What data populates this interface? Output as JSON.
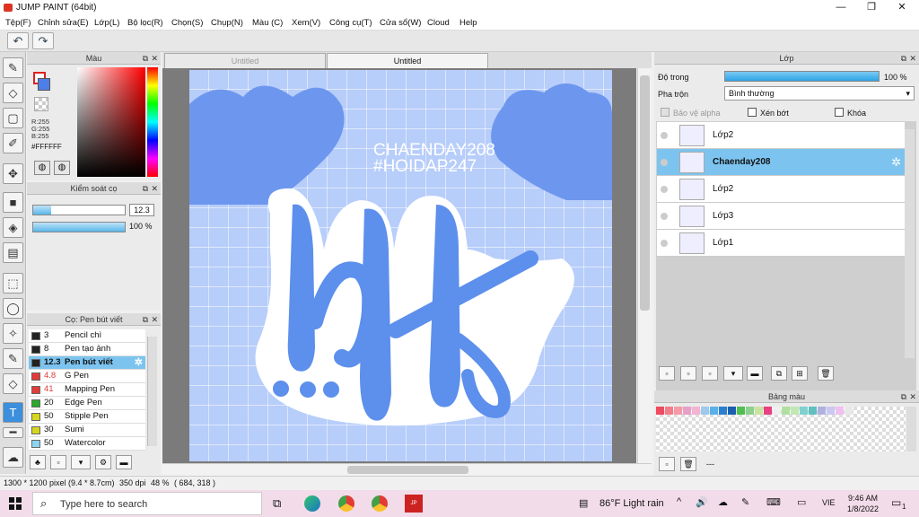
{
  "window": {
    "title": "JUMP PAINT (64bit)"
  },
  "menu": [
    "Tệp(F)",
    "Chỉnh sửa(E)",
    "Lớp(L)",
    "Bộ lọc(R)",
    "Chọn(S)",
    "Chụp(N)",
    "Màu (C)",
    "Xem(V)",
    "Công cụ(T)",
    "Cửa sổ(W)",
    "Cloud",
    "Help"
  ],
  "color_panel": {
    "title": "Màu",
    "r": "R:255",
    "g": "G:255",
    "b": "B:255",
    "hex": "#FFFFFF"
  },
  "brush_control": {
    "title": "Kiểm soát cọ",
    "size": "12.3",
    "opacity": "100 %",
    "size_fraction": 0.2,
    "opacity_fraction": 1.0
  },
  "brush_list": {
    "title": "Cọ: Pen bút viết",
    "items": [
      {
        "size": "3",
        "name": "Pencil chì",
        "color": "#222222"
      },
      {
        "size": "8",
        "name": "Pen tạo ảnh",
        "color": "#222222"
      },
      {
        "size": "12.3",
        "name": "Pen bút viết",
        "color": "#222222",
        "selected": true
      },
      {
        "size": "4.8",
        "name": "G Pen",
        "color": "#e33b3b"
      },
      {
        "size": "41",
        "name": "Mapping Pen",
        "color": "#e33b3b"
      },
      {
        "size": "20",
        "name": "Edge Pen",
        "color": "#2ba82b"
      },
      {
        "size": "50",
        "name": "Stipple Pen",
        "color": "#d6d61e"
      },
      {
        "size": "30",
        "name": "Sumi",
        "color": "#d6d61e"
      },
      {
        "size": "50",
        "name": "Watercolor",
        "color": "#8ad6f0"
      }
    ]
  },
  "tabs": [
    "Untitled",
    "Untitled"
  ],
  "artwork": {
    "line1": "CHAENDAY208",
    "line2": "#HOIDAP247"
  },
  "layer_panel": {
    "title": "Lớp",
    "opacity_label": "Độ trong",
    "opacity_value": "100 %",
    "blend_label": "Pha trộn",
    "blend_value": "Bình thường",
    "protect_alpha": "Bảo vệ alpha",
    "clipping": "Xén bớt",
    "lock": "Khóa",
    "layers": [
      {
        "name": "Lớp2",
        "selected": false
      },
      {
        "name": "Chaenday208",
        "selected": true
      },
      {
        "name": "Lớp2",
        "selected": false
      },
      {
        "name": "Lớp3",
        "selected": false
      },
      {
        "name": "Lớp1",
        "selected": false
      }
    ]
  },
  "palette_panel": {
    "title": "Bảng màu",
    "dashes": "---",
    "colors": [
      "#f04a5e",
      "#f47c8a",
      "#f59aa6",
      "#e8a0c8",
      "#f2b4d0",
      "#9ec8ee",
      "#5ab0e8",
      "#2a7fd0",
      "#1a5fb0",
      "#4fc04f",
      "#8ed08e",
      "#c9e4a0",
      "#e84080",
      "#f0f0f0",
      "#b0e0a0",
      "#c0e8b0",
      "#80d0d0",
      "#60c0c0",
      "#b0b0e0",
      "#c8c8f0",
      "#f0c0f0",
      "#e8e8e8"
    ]
  },
  "status": {
    "dimensions": "1300 * 1200 pixel",
    "size_cm": "(9.4 * 8.7cm)",
    "dpi": "350 dpi",
    "zoom": "48 %",
    "cursor": "( 684, 318 )"
  },
  "taskbar": {
    "search_placeholder": "Type here to search",
    "weather": "86°F  Light rain",
    "lang": "VIE",
    "time": "9:46 AM",
    "date": "1/8/2022",
    "notif_count": "1"
  }
}
